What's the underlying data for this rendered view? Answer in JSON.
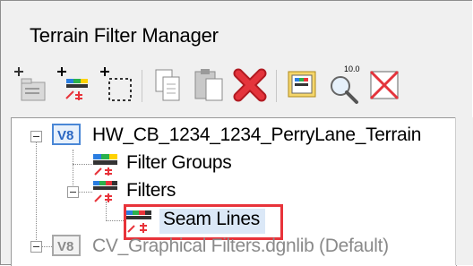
{
  "window": {
    "title": "Terrain Filter Manager"
  },
  "toolbar": {
    "buttons": [
      {
        "name": "add-group-button",
        "icon": "add-folder-icon"
      },
      {
        "name": "add-filter-button",
        "icon": "add-filter-icon"
      },
      {
        "name": "add-selection-button",
        "icon": "add-selection-icon"
      },
      {
        "name": "copy-button",
        "icon": "copy-icon"
      },
      {
        "name": "paste-button",
        "icon": "paste-icon"
      },
      {
        "name": "delete-button",
        "icon": "delete-x-icon"
      },
      {
        "name": "view-filter-button",
        "icon": "view-filter-icon"
      },
      {
        "name": "zoom-filter-button",
        "icon": "zoom-magnifier-icon",
        "badge": "10.0"
      },
      {
        "name": "clear-filter-button",
        "icon": "clear-filter-icon"
      }
    ]
  },
  "tree": {
    "root": {
      "badge": "V8",
      "label": "HW_CB_1234_1234_PerryLane_Terrain"
    },
    "filter_groups": {
      "label": "Filter Groups"
    },
    "filters": {
      "label": "Filters"
    },
    "seam_lines": {
      "label": "Seam Lines"
    },
    "library": {
      "badge": "V8",
      "label": "CV_Graphical Filters.dgnlib (Default)"
    }
  },
  "colors": {
    "highlight_border": "#e8333a",
    "selected_row": "#dbe8f7",
    "delete_red": "#d7232b"
  }
}
